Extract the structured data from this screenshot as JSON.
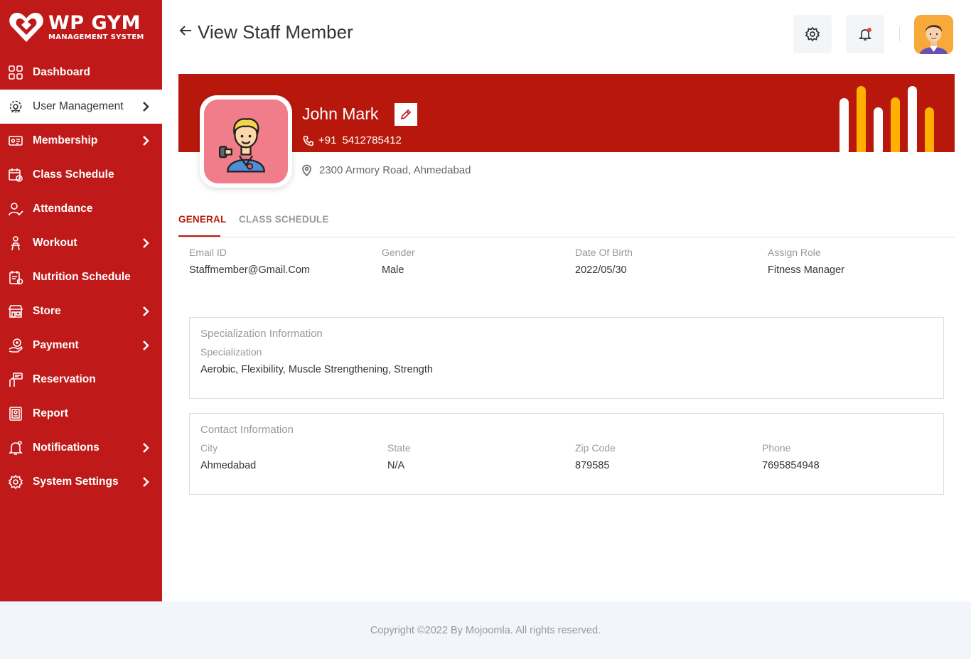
{
  "brand": {
    "name": "WP GYM",
    "subtitle": "MANAGEMENT SYSTEM"
  },
  "sidebar": {
    "items": [
      {
        "label": "Dashboard",
        "icon": "dashboard-icon",
        "has_chevron": false,
        "active": false
      },
      {
        "label": "User Management",
        "icon": "user-management-icon",
        "has_chevron": true,
        "active": true
      },
      {
        "label": "Membership",
        "icon": "membership-icon",
        "has_chevron": true,
        "active": false
      },
      {
        "label": "Class Schedule",
        "icon": "class-schedule-icon",
        "has_chevron": false,
        "active": false
      },
      {
        "label": "Attendance",
        "icon": "attendance-icon",
        "has_chevron": false,
        "active": false
      },
      {
        "label": "Workout",
        "icon": "workout-icon",
        "has_chevron": true,
        "active": false
      },
      {
        "label": "Nutrition Schedule",
        "icon": "nutrition-icon",
        "has_chevron": false,
        "active": false
      },
      {
        "label": "Store",
        "icon": "store-icon",
        "has_chevron": true,
        "active": false
      },
      {
        "label": "Payment",
        "icon": "payment-icon",
        "has_chevron": true,
        "active": false
      },
      {
        "label": "Reservation",
        "icon": "reservation-icon",
        "has_chevron": false,
        "active": false
      },
      {
        "label": "Report",
        "icon": "report-icon",
        "has_chevron": false,
        "active": false
      },
      {
        "label": "Notifications",
        "icon": "notifications-icon",
        "has_chevron": true,
        "active": false
      },
      {
        "label": "System Settings",
        "icon": "system-settings-icon",
        "has_chevron": true,
        "active": false
      }
    ]
  },
  "header": {
    "title": "View Staff Member"
  },
  "profile": {
    "name": "John Mark",
    "phone_code": "+91",
    "phone": "5412785412",
    "address": "2300 Armory Road, Ahmedabad"
  },
  "tabs": [
    {
      "label": "GENERAL",
      "active": true
    },
    {
      "label": "CLASS SCHEDULE",
      "active": false
    }
  ],
  "general": {
    "email_label": "Email ID",
    "email_value": "Staffmember@Gmail.Com",
    "gender_label": "Gender",
    "gender_value": "Male",
    "dob_label": "Date Of Birth",
    "dob_value": "2022/05/30",
    "role_label": "Assign Role",
    "role_value": "Fitness Manager"
  },
  "specialization": {
    "title": "Specialization Information",
    "label": "Specialization",
    "value": "Aerobic, Flexibility, Muscle Strengthening, Strength"
  },
  "contact": {
    "title": "Contact Information",
    "city_label": "City",
    "city_value": "Ahmedabad",
    "state_label": "State",
    "state_value": "N/A",
    "zip_label": "Zip Code",
    "zip_value": "879585",
    "phone_label": "Phone",
    "phone_value": "7695854948"
  },
  "footer": {
    "text": "Copyright ©2022 By Mojoomla. All rights reserved."
  },
  "colors": {
    "sidebar_red": "#c0191a",
    "banner_red": "#b8180c",
    "accent_yellow": "#ffb000",
    "profile_bg": "#f27d8a",
    "avatar_bg": "#f7a93a"
  }
}
